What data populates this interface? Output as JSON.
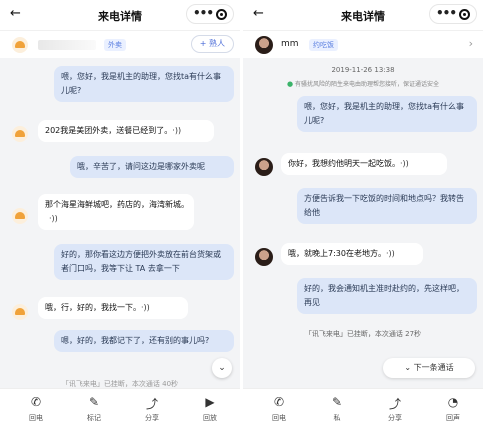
{
  "left": {
    "header": {
      "title": "来电详情"
    },
    "contact": {
      "tag": "外卖",
      "add_label": "+ 熟人"
    },
    "messages": [
      {
        "from": "assistant",
        "text": "喂，您好，我是机主的助理，您找ta有什么事儿呢?"
      },
      {
        "from": "caller",
        "text": "202我是美团外卖，送餐已经到了。"
      },
      {
        "from": "assistant",
        "text": "哦，辛苦了，请问这边是哪家外卖呢"
      },
      {
        "from": "caller",
        "text": "那个海星海鲜城吧，药店的，海湾新城。"
      },
      {
        "from": "assistant",
        "text": "好的，那你看这边方便把外卖放在前台货架或者门口吗，我等下让 TA 去拿一下"
      },
      {
        "from": "caller",
        "text": "哦，行，好的，我找一下。"
      },
      {
        "from": "assistant",
        "text": "嗯，好的，我都记下了，还有别的事儿吗?"
      }
    ],
    "end_note": "「讯飞来电」已挂断，本次通话 40秒",
    "scroll_btn": "⌄",
    "bottom": [
      {
        "icon": "✆",
        "label": "回电"
      },
      {
        "icon": "✎",
        "label": "标记"
      },
      {
        "icon": "⤴",
        "label": "分享"
      },
      {
        "icon": "▶",
        "label": "回放"
      }
    ]
  },
  "right": {
    "header": {
      "title": "来电详情"
    },
    "contact": {
      "name": "mm",
      "tag": "约吃饭"
    },
    "timestamp": "2019-11-26 13:38",
    "secure_note": "有骚扰风险的陌生来电由助理帮您接听，保证通话安全",
    "messages": [
      {
        "from": "assistant",
        "text": "喂，您好，我是机主的助理，您找ta有什么事儿呢?"
      },
      {
        "from": "caller",
        "text": "你好，我想约他明天一起吃饭。"
      },
      {
        "from": "assistant",
        "text": "方便告诉我一下吃饭的时间和地点吗？我转告给他"
      },
      {
        "from": "caller",
        "text": "哦，就晚上7:30在老地方。"
      },
      {
        "from": "assistant",
        "text": "好的，我会通知机主准时赴约的，先这样吧，再见"
      }
    ],
    "end_note": "「讯飞来电」已挂断，本次通话 27秒",
    "next_label": "下一条通话",
    "bottom": [
      {
        "icon": "✆",
        "label": "回电"
      },
      {
        "icon": "✎",
        "label": "私"
      },
      {
        "icon": "⤴",
        "label": "分享"
      },
      {
        "icon": "◔",
        "label": "回声"
      }
    ]
  },
  "voice_glyph": "·))"
}
